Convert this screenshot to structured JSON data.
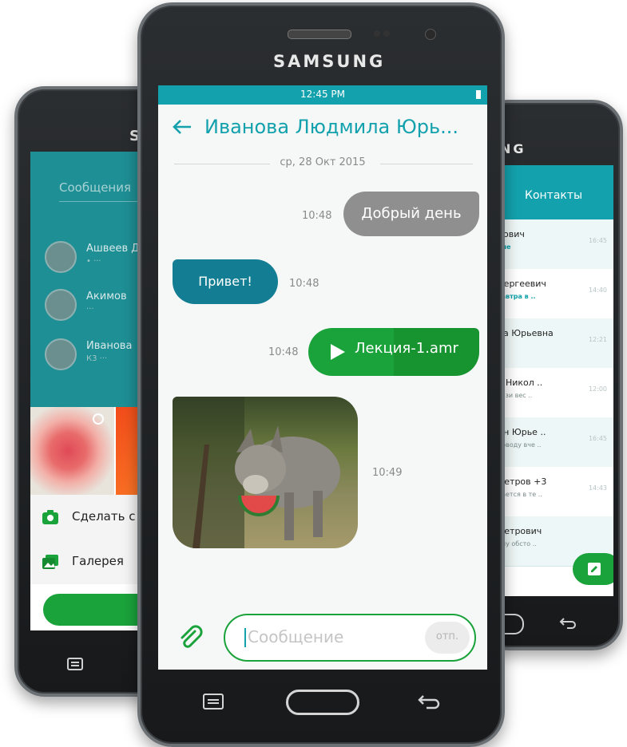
{
  "colors": {
    "teal": "#13a2ad",
    "green": "#1aa33b",
    "grey": "#8f8f8f",
    "outgoing_blue": "#137e93"
  },
  "left_phone": {
    "brand": "SA",
    "search_placeholder": "Сообщения",
    "contacts": [
      {
        "name": "Ашвеев Д",
        "sub": "• ···"
      },
      {
        "name": "Акимов",
        "sub": "···"
      },
      {
        "name": "Иванова",
        "sub": "К3 ···"
      }
    ],
    "menu": {
      "camera": "Сделать с",
      "gallery": "Галерея"
    },
    "icons": [
      "camera-icon",
      "gallery-icon",
      "check-circle-icon",
      "menu-icon"
    ]
  },
  "right_phone": {
    "brand": "NG",
    "title": "Контакты",
    "rows": [
      {
        "name": "рович",
        "sub": "ние",
        "time": "16:45",
        "hl": true
      },
      {
        "name": "Сергеевич",
        "sub": "завтра в ..",
        "time": "14:40",
        "hl": true
      },
      {
        "name": "ла Юрьевна",
        "sub": "",
        "time": "12:21",
        "hl": false
      },
      {
        "name": "в Никол ..",
        "sub": "вази вес ..",
        "time": "12:00",
        "hl": false
      },
      {
        "name": "ин Юрье ..",
        "sub": "поводу вче ..",
        "time": "16:45",
        "hl": false
      },
      {
        "name": "Петров +3",
        "sub": "рается в те ..",
        "time": "14:43",
        "hl": false
      },
      {
        "name": "Петрович",
        "sub": "ону обсто ..",
        "time": "",
        "hl": false
      }
    ],
    "icons": [
      "compose-icon",
      "back-icon"
    ]
  },
  "center_phone": {
    "brand": "SAMSUNG",
    "status_time": "12:45 PM",
    "contact_name": "Иванова Людмила Юрь...",
    "date": "ср, 28 Окт 2015",
    "messages": [
      {
        "text": "Добрый день",
        "time": "10:48",
        "dir": "out"
      },
      {
        "text": "Привет!",
        "time": "10:48",
        "dir": "in"
      },
      {
        "text": "Лекция-1.amr",
        "time": "10:48",
        "dir": "out",
        "type": "audio"
      },
      {
        "text": "",
        "time": "10:49",
        "dir": "in",
        "type": "image"
      }
    ],
    "input_placeholder": "Сообщение",
    "send_label": "отп.",
    "icons": [
      "back-arrow-icon",
      "play-icon",
      "attach-icon",
      "menu-icon",
      "home-button",
      "back-icon"
    ]
  }
}
